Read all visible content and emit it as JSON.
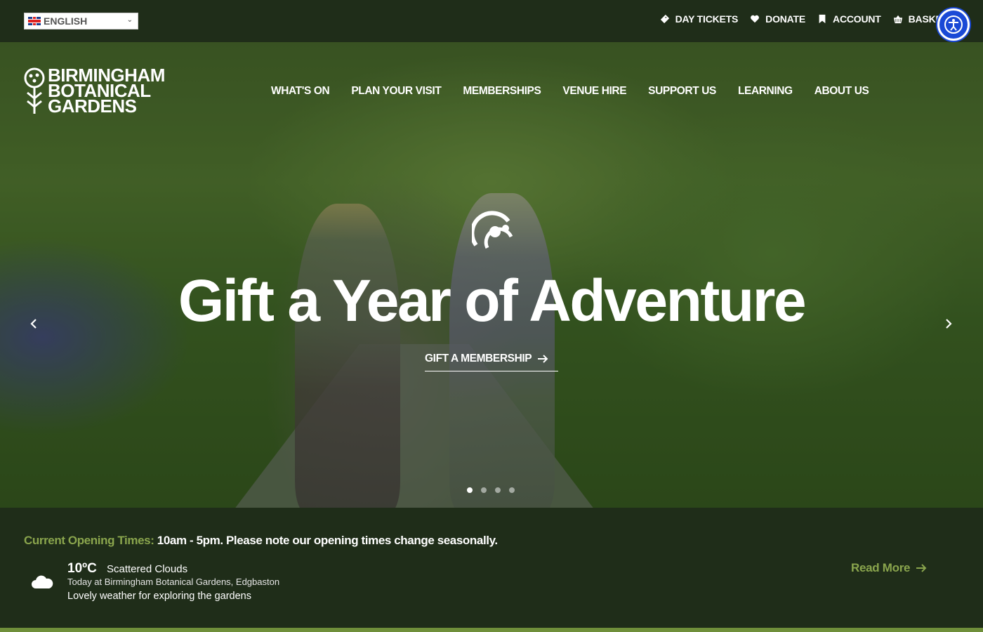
{
  "topbar": {
    "language": "ENGLISH",
    "links": [
      {
        "label": "DAY TICKETS",
        "icon": "ticket-icon"
      },
      {
        "label": "DONATE",
        "icon": "heart-icon"
      },
      {
        "label": "ACCOUNT",
        "icon": "bookmark-icon"
      },
      {
        "label": "BASKET",
        "icon": "basket-icon"
      }
    ]
  },
  "logo": {
    "line1": "BIRMINGHAM",
    "line2": "BOTANICAL",
    "line3": "GARDENS"
  },
  "nav": [
    "WHAT'S ON",
    "PLAN YOUR VISIT",
    "MEMBERSHIPS",
    "VENUE HIRE",
    "SUPPORT US",
    "LEARNING",
    "ABOUT US"
  ],
  "hero": {
    "headline": "Gift a Year of Adventure",
    "cta": "GIFT A MEMBERSHIP",
    "slides": 4,
    "active_slide": 1
  },
  "info": {
    "hours_label": "Current Opening Times:",
    "hours_value": "10am - 5pm. Please note our opening times change seasonally.",
    "temperature": "10ºC",
    "condition": "Scattered Clouds",
    "location": "Today at Birmingham Botanical Gardens, Edgbaston",
    "note": "Lovely weather for exploring the gardens",
    "read_more": "Read More"
  },
  "colors": {
    "dark_green": "#1f2d19",
    "accent_green": "#8aa54d",
    "accessibility_blue": "#1a49d6"
  }
}
